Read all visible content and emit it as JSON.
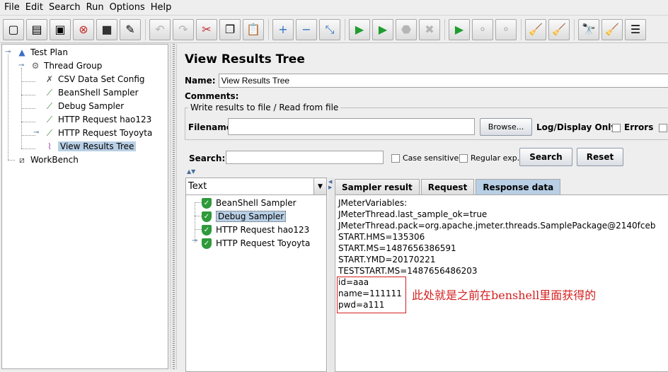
{
  "menu": [
    "File",
    "Edit",
    "Search",
    "Run",
    "Options",
    "Help"
  ],
  "toolbar": {
    "buttons": [
      {
        "icon": "new-icon",
        "glyph": "▢"
      },
      {
        "icon": "templates-icon",
        "glyph": "▤"
      },
      {
        "icon": "open-icon",
        "glyph": "▣"
      },
      {
        "icon": "close-icon",
        "glyph": "⊗"
      },
      {
        "icon": "save-icon",
        "glyph": "■"
      },
      {
        "icon": "save-as-icon",
        "glyph": "✎"
      },
      {
        "icon": "undo-icon",
        "glyph": "↶"
      },
      {
        "icon": "redo-icon",
        "glyph": "↷"
      },
      {
        "icon": "cut-icon",
        "glyph": "✂"
      },
      {
        "icon": "copy-icon",
        "glyph": "❐"
      },
      {
        "icon": "paste-icon",
        "glyph": "📋"
      },
      {
        "icon": "expand-icon",
        "glyph": "+"
      },
      {
        "icon": "collapse-icon",
        "glyph": "−"
      },
      {
        "icon": "toggle-icon",
        "glyph": "⤡"
      },
      {
        "icon": "start-icon",
        "glyph": "▶"
      },
      {
        "icon": "start-no-timers-icon",
        "glyph": "▶"
      },
      {
        "icon": "stop-icon",
        "glyph": "⬣"
      },
      {
        "icon": "shutdown-icon",
        "glyph": "✖"
      },
      {
        "icon": "remote-start-icon",
        "glyph": "▶"
      },
      {
        "icon": "remote-stop-icon",
        "glyph": "⚬"
      },
      {
        "icon": "remote-shutdown-icon",
        "glyph": "⚬"
      },
      {
        "icon": "clear-icon",
        "glyph": "🧹"
      },
      {
        "icon": "clear-all-icon",
        "glyph": "🧹"
      },
      {
        "icon": "search-icon",
        "glyph": "🔭"
      },
      {
        "icon": "reset-search-icon",
        "glyph": "🧹"
      },
      {
        "icon": "function-helper-icon",
        "glyph": "☰"
      }
    ]
  },
  "tree": {
    "test_plan": "Test Plan",
    "thread_group": "Thread Group",
    "csv_config": "CSV Data Set Config",
    "beanshell": "BeanShell Sampler",
    "debug": "Debug Sampler",
    "http_hao123": "HTTP Request  hao123",
    "http_toyota": "HTTP Request  Toyoyta",
    "view_results": "View Results Tree",
    "workbench": "WorkBench"
  },
  "panel": {
    "title": "View Results Tree",
    "name_label": "Name:",
    "name_value": "View Results Tree",
    "comments_label": "Comments:",
    "file_legend": "Write results to file / Read from file",
    "filename_label": "Filename",
    "filename_value": "",
    "browse_label": "Browse...",
    "log_display_label": "Log/Display Only:",
    "errors_label": "Errors"
  },
  "search": {
    "label": "Search:",
    "value": "",
    "case_sensitive_label": "Case sensitive",
    "regex_label": "Regular exp.",
    "search_button": "Search",
    "reset_button": "Reset"
  },
  "results": {
    "renderer": "Text",
    "samples": [
      "BeanShell Sampler",
      "Debug Sampler",
      "HTTP Request  hao123",
      "HTTP Request  Toyoyta"
    ],
    "tabs": [
      "Sampler result",
      "Request",
      "Response data"
    ],
    "active_tab": "Response data",
    "response_lines": [
      "JMeterVariables:",
      "JMeterThread.last_sample_ok=true",
      "JMeterThread.pack=org.apache.jmeter.threads.SamplePackage@2140fceb",
      "START.HMS=135306",
      "START.MS=1487656386591",
      "START.YMD=20170221",
      "TESTSTART.MS=1487656486203",
      "id=aaa",
      "name=111111",
      "pwd=a111"
    ],
    "annotation": "此处就是之前在benshell里面获得的"
  }
}
